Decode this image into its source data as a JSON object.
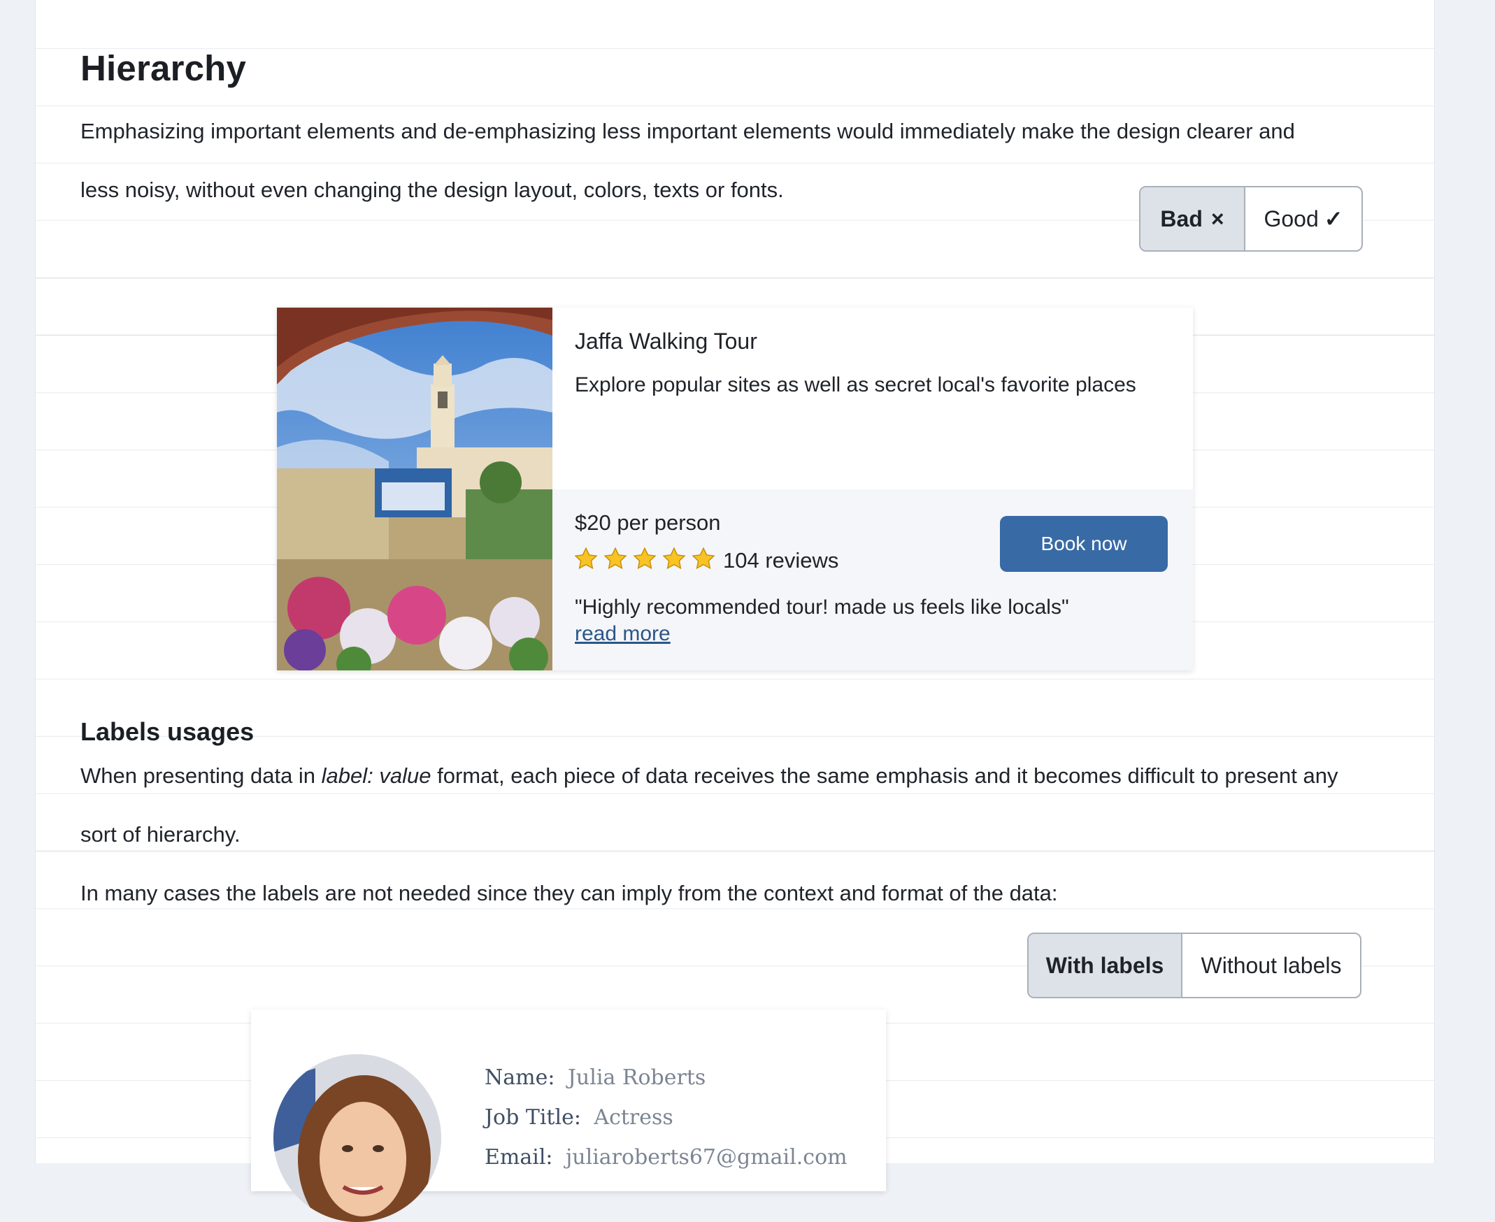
{
  "hierarchy": {
    "title": "Hierarchy",
    "paragraph_line1": "Emphasizing important elements and de-emphasizing less important elements would immediately make the design clearer and",
    "paragraph_line2": "less noisy, without even changing the design layout, colors, texts or fonts.",
    "toggle": {
      "bad_label": "Bad",
      "bad_icon": "×",
      "good_label": "Good",
      "good_icon": "✓",
      "selected": "Bad"
    }
  },
  "tour_card": {
    "title": "Jaffa Walking Tour",
    "description": "Explore popular sites as well as secret local's favorite places",
    "price": "$20 per person",
    "rating_stars": 5,
    "reviews": "104 reviews",
    "button_label": "Book now",
    "quote": "\"Highly recommended tour! made us feels like locals\"",
    "read_more": "read more",
    "accent_color": "#386aa5"
  },
  "labels": {
    "title": "Labels usages",
    "p1_before": "When presenting data in ",
    "p1_italic": "label: value",
    "p1_after": " format, each piece of data receives the same emphasis and it becomes difficult to present any",
    "p1_line2": "sort of hierarchy.",
    "p2": "In many cases the labels are not needed since they can imply from the context and format of the data:",
    "toggle": {
      "with_label": "With labels",
      "without_label": "Without labels",
      "selected": "With labels"
    }
  },
  "profile": {
    "rows": [
      {
        "label": "Name:",
        "value": "Julia Roberts"
      },
      {
        "label": "Job Title:",
        "value": "Actress"
      },
      {
        "label": "Email:",
        "value": "juliaroberts67@gmail.com"
      }
    ]
  }
}
